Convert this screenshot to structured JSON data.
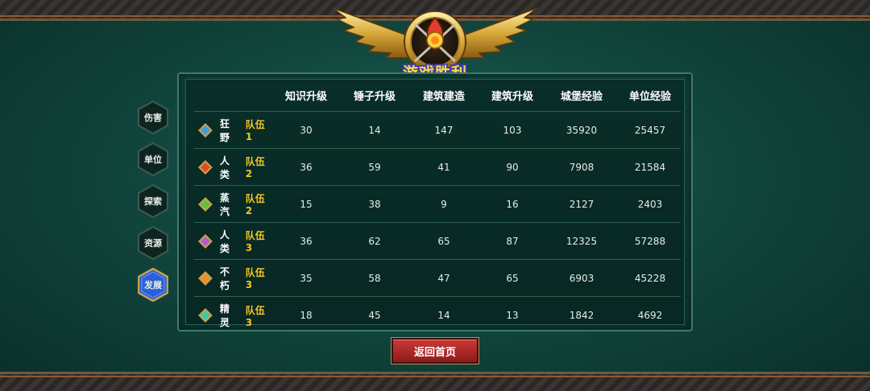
{
  "title": "游戏胜利",
  "tabs": [
    {
      "label": "伤害",
      "active": false
    },
    {
      "label": "单位",
      "active": false
    },
    {
      "label": "探索",
      "active": false
    },
    {
      "label": "资源",
      "active": false
    },
    {
      "label": "发展",
      "active": true
    }
  ],
  "table": {
    "columns": [
      "知识升级",
      "锤子升级",
      "建筑建造",
      "建筑升级",
      "城堡经验",
      "单位经验"
    ],
    "rows": [
      {
        "race": "狂野",
        "team": "队伍1",
        "gem_color": "#3aa0e0",
        "values": [
          "30",
          "14",
          "147",
          "103",
          "35920",
          "25457"
        ]
      },
      {
        "race": "人类",
        "team": "队伍2",
        "gem_color": "#e04a2a",
        "values": [
          "36",
          "59",
          "41",
          "90",
          "7908",
          "21584"
        ]
      },
      {
        "race": "蒸汽",
        "team": "队伍2",
        "gem_color": "#5fc23a",
        "values": [
          "15",
          "38",
          "9",
          "16",
          "2127",
          "2403"
        ]
      },
      {
        "race": "人类",
        "team": "队伍3",
        "gem_color": "#b35ad6",
        "values": [
          "36",
          "62",
          "65",
          "87",
          "12325",
          "57288"
        ]
      },
      {
        "race": "不朽",
        "team": "队伍3",
        "gem_color": "#f0902a",
        "values": [
          "35",
          "58",
          "47",
          "65",
          "6903",
          "45228"
        ]
      },
      {
        "race": "精灵",
        "team": "队伍3",
        "gem_color": "#3cc8b0",
        "values": [
          "18",
          "45",
          "14",
          "13",
          "1842",
          "4692"
        ]
      }
    ]
  },
  "return_button": "返回首页",
  "colors": {
    "team_text": "#f3c623",
    "active_tab": "#2a5fd8",
    "return_button": "#b52c29"
  },
  "icons": {
    "emblem": "winged-crest-icon",
    "row_marker": "diamond-gem-icon",
    "tab_shape": "hexagon"
  }
}
